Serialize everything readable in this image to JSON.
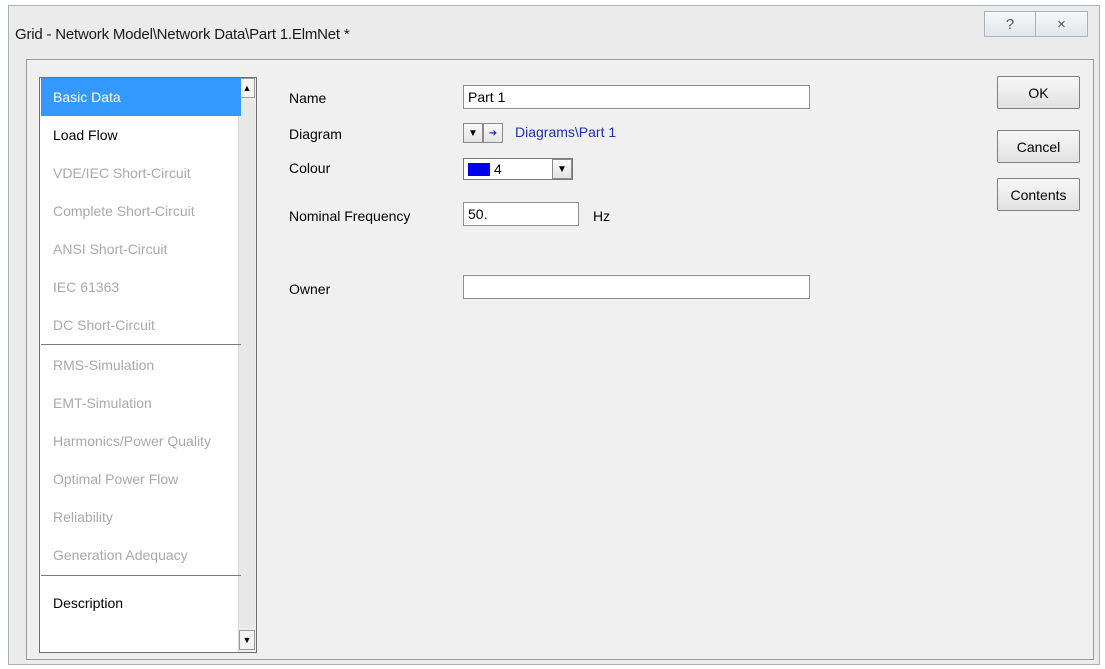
{
  "window": {
    "title": "Grid - Network Model\\Network Data\\Part 1.ElmNet *",
    "help_glyph": "?",
    "close_glyph": "×"
  },
  "nav": {
    "items": [
      {
        "label": "Basic Data",
        "state": "selected"
      },
      {
        "label": "Load Flow",
        "state": "enabled"
      },
      {
        "label": "VDE/IEC Short-Circuit",
        "state": "disabled"
      },
      {
        "label": "Complete Short-Circuit",
        "state": "disabled"
      },
      {
        "label": "ANSI Short-Circuit",
        "state": "disabled"
      },
      {
        "label": "IEC 61363",
        "state": "disabled"
      },
      {
        "label": "DC Short-Circuit",
        "state": "disabled"
      },
      {
        "label": "RMS-Simulation",
        "state": "disabled"
      },
      {
        "label": "EMT-Simulation",
        "state": "disabled"
      },
      {
        "label": "Harmonics/Power Quality",
        "state": "disabled"
      },
      {
        "label": "Optimal Power Flow",
        "state": "disabled"
      },
      {
        "label": "Reliability",
        "state": "disabled"
      },
      {
        "label": "Generation Adequacy",
        "state": "disabled"
      },
      {
        "label": "Description",
        "state": "enabled"
      }
    ],
    "scroll_up": "▲",
    "scroll_down": "▼"
  },
  "form": {
    "name_label": "Name",
    "name_value": "Part 1",
    "diagram_label": "Diagram",
    "diagram_dropdown_glyph": "▼",
    "diagram_jump_glyph": "➔",
    "diagram_link": "Diagrams\\Part 1",
    "colour_label": "Colour",
    "colour_value": "4",
    "colour_swatch": "#0000ee",
    "colour_dropdown_glyph": "▼",
    "freq_label": "Nominal Frequency",
    "freq_value": "50.",
    "freq_unit": "Hz",
    "owner_label": "Owner",
    "owner_value": ""
  },
  "buttons": {
    "ok": "OK",
    "cancel": "Cancel",
    "contents": "Contents"
  }
}
